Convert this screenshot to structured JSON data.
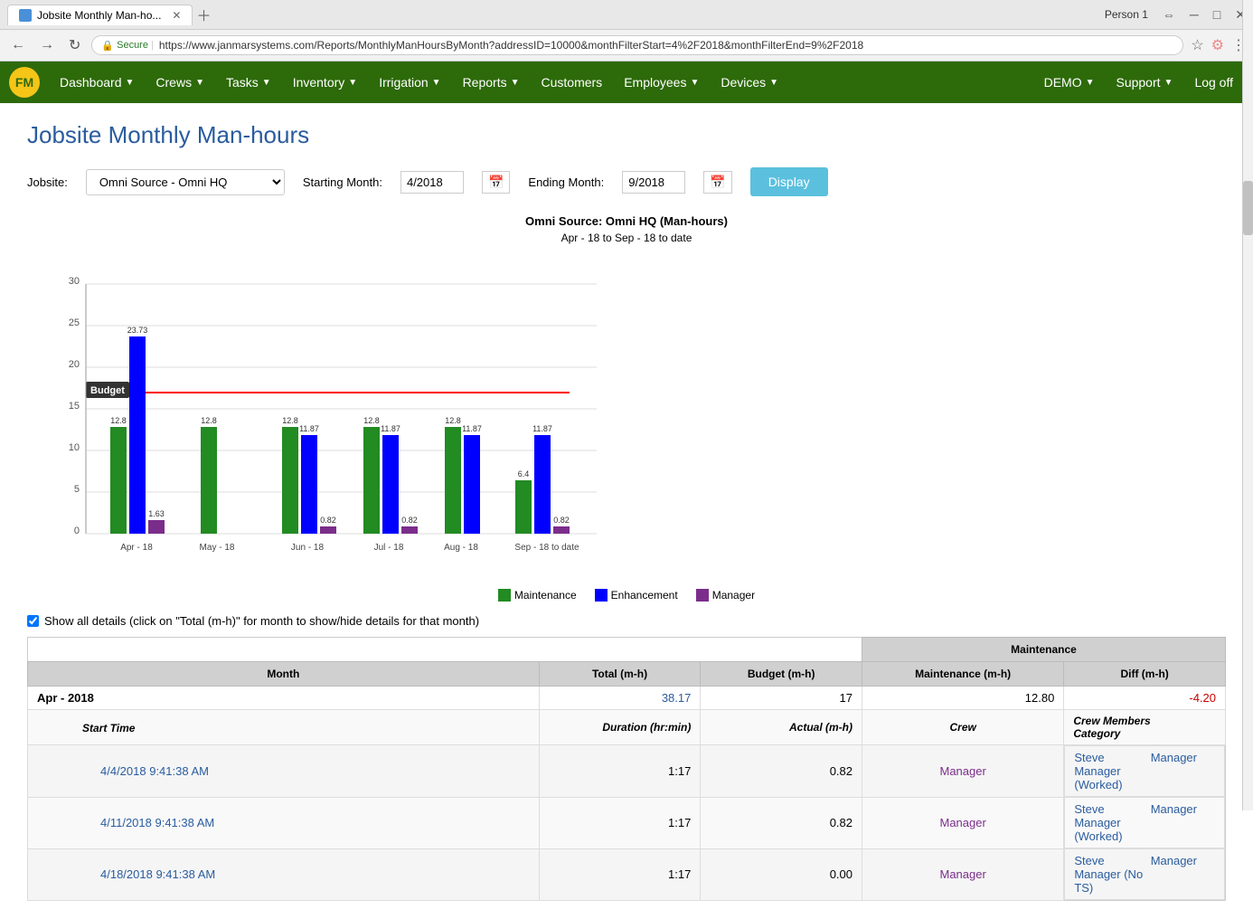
{
  "browser": {
    "tab_title": "Jobsite Monthly Man-ho...",
    "url": "https://www.janmarsystems.com/Reports/MonthlyManHoursByMonth?addressID=10000&monthFilterStart=4%2F2018&monthFilterEnd=9%2F2018",
    "user": "Person 1"
  },
  "navbar": {
    "brand": "FM",
    "items": [
      {
        "label": "Dashboard",
        "has_dropdown": true
      },
      {
        "label": "Crews",
        "has_dropdown": true
      },
      {
        "label": "Tasks",
        "has_dropdown": true
      },
      {
        "label": "Inventory",
        "has_dropdown": true
      },
      {
        "label": "Irrigation",
        "has_dropdown": true
      },
      {
        "label": "Reports",
        "has_dropdown": true
      },
      {
        "label": "Customers",
        "has_dropdown": false
      },
      {
        "label": "Employees",
        "has_dropdown": true
      },
      {
        "label": "Devices",
        "has_dropdown": true
      }
    ],
    "right_items": [
      {
        "label": "DEMO",
        "has_dropdown": true
      },
      {
        "label": "Support",
        "has_dropdown": true
      },
      {
        "label": "Log off",
        "has_dropdown": false
      }
    ]
  },
  "page": {
    "title": "Jobsite Monthly Man-hours",
    "jobsite_label": "Jobsite:",
    "jobsite_value": "Omni Source - Omni HQ",
    "starting_month_label": "Starting Month:",
    "starting_month_value": "4/2018",
    "ending_month_label": "Ending Month:",
    "ending_month_value": "9/2018",
    "display_button": "Display"
  },
  "chart": {
    "title": "Omni Source:  Omni HQ (Man-hours)",
    "subtitle": "Apr - 18 to Sep - 18 to date",
    "budget_line_label": "Budget",
    "budget_value": 17,
    "y_labels": [
      "0",
      "5",
      "10",
      "15",
      "20",
      "25",
      "30"
    ],
    "months": [
      "Apr - 18",
      "May - 18",
      "Jun - 18",
      "Jul - 18",
      "Aug - 18",
      "Sep - 18 to date"
    ],
    "maintenance": [
      12.8,
      12.8,
      12.8,
      12.8,
      12.8,
      6.4
    ],
    "enhancement": [
      23.73,
      0,
      11.87,
      11.87,
      11.87,
      11.87
    ],
    "manager": [
      1.63,
      0,
      0.82,
      0.82,
      0,
      0.82
    ],
    "legend": [
      {
        "label": "Maintenance",
        "color": "#228B22"
      },
      {
        "label": "Enhancement",
        "color": "#0000FF"
      },
      {
        "label": "Manager",
        "color": "#7b2d8b"
      }
    ]
  },
  "details": {
    "checkbox_label": "Show all details (click on \"Total (m-h)\" for month to show/hide details for that month)"
  },
  "table": {
    "maintenance_header": "Maintenance",
    "columns": {
      "month": "Month",
      "total_mh": "Total (m-h)",
      "budget_mh": "Budget (m-h)",
      "maintenance_mh": "Maintenance (m-h)",
      "diff_mh": "Diff (m-h)"
    },
    "sub_columns": {
      "start_time": "Start Time",
      "duration": "Duration (hr:min)",
      "actual_mh": "Actual (m-h)",
      "crew": "Crew",
      "crew_members": "Crew Members",
      "category": "Category"
    },
    "rows": [
      {
        "month": "Apr - 2018",
        "total_mh": "38.17",
        "budget_mh": "17",
        "maintenance_mh": "12.80",
        "diff_mh": "-4.20",
        "details": [
          {
            "start_time": "4/4/2018 9:41:38 AM",
            "duration": "1:17",
            "actual_mh": "0.82",
            "crew": "Manager",
            "crew_members": "Steve Manager (Worked)",
            "category": "Manager"
          },
          {
            "start_time": "4/11/2018 9:41:38 AM",
            "duration": "1:17",
            "actual_mh": "0.82",
            "crew": "Manager",
            "crew_members": "Steve Manager (Worked)",
            "category": "Manager"
          },
          {
            "start_time": "4/18/2018 9:41:38 AM",
            "duration": "1:17",
            "actual_mh": "0.00",
            "crew": "Manager",
            "crew_members": "Steve Manager (No TS)",
            "category": "Manager"
          }
        ]
      }
    ]
  }
}
